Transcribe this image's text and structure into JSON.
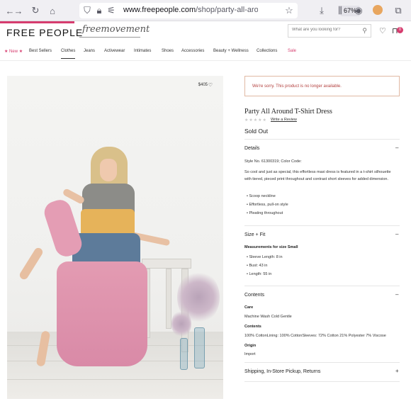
{
  "browser": {
    "url_host": "www.freepeople.com",
    "url_path": "/shop/party-all-arou",
    "zoom": "67%"
  },
  "header": {
    "logo": "FREE PEOPLE",
    "sub_brand": "freemovement",
    "search_placeholder": "What are you looking for?",
    "bag_count": "0"
  },
  "nav": {
    "items": [
      {
        "label": "★ New ★",
        "style": "pink"
      },
      {
        "label": "Best Sellers",
        "style": ""
      },
      {
        "label": "Clothes",
        "style": "active"
      },
      {
        "label": "Jeans",
        "style": ""
      },
      {
        "label": "Activewear",
        "style": ""
      },
      {
        "label": "Intimates",
        "style": ""
      },
      {
        "label": "Shoes",
        "style": ""
      },
      {
        "label": "Accessories",
        "style": ""
      },
      {
        "label": "Beauty + Wellness",
        "style": ""
      },
      {
        "label": "Collections",
        "style": ""
      },
      {
        "label": "Sale",
        "style": "pink"
      }
    ]
  },
  "product": {
    "price": "$405",
    "notice": "We're sorry. This product is no longer available.",
    "title": "Party All Around T-Shirt Dress",
    "stars": "★★★★★",
    "write_review": "Write a Review",
    "status": "Sold Out"
  },
  "details": {
    "heading": "Details",
    "style_no": "Style No. 61300319; Color Code:",
    "description": "So cool and just as special, this effortless maxi dress is featured in a t-shirt silhouette with tiered, pieced print throughout and contrast short sleeves for added dimension.",
    "bullets": [
      "Scoop neckline",
      "Effortless, pull-on style",
      "Pleating throughout"
    ]
  },
  "size_fit": {
    "heading": "Size + Fit",
    "label": "Measurements for size Small",
    "bullets": [
      "Sleeve Length: 8 in",
      "Bust: 43 in",
      "Length: 55 in"
    ]
  },
  "contents": {
    "heading": "Contents",
    "care_label": "Care",
    "care": "Machine Wash Cold Gentle",
    "contents_label": "Contents",
    "contents": "100% CottonLining: 100% CottonSleeves: 72% Cotton 21% Polyester 7% Viscose",
    "origin_label": "Origin",
    "origin": "Import"
  },
  "shipping": {
    "heading": "Shipping, In-Store Pickup, Returns"
  },
  "colors": {
    "brand_pink": "#d63c6e",
    "notice_red": "#b3403e"
  }
}
